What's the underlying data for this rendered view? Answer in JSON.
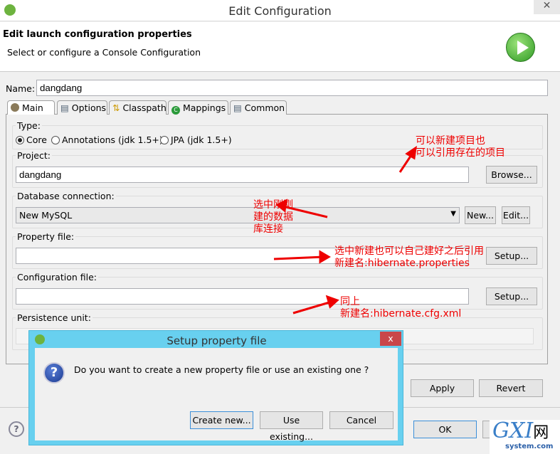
{
  "window": {
    "title": "Edit Configuration",
    "close": "✕"
  },
  "header": {
    "title": "Edit launch configuration properties",
    "subtitle": "Select or configure a Console Configuration"
  },
  "name": {
    "label": "Name:",
    "value": "dangdang"
  },
  "tabs": [
    {
      "label": "Main",
      "icon": "main-icon"
    },
    {
      "label": "Options",
      "icon": "table-icon"
    },
    {
      "label": "Classpath",
      "icon": "classpath-icon"
    },
    {
      "label": "Mappings",
      "icon": "mappings-icon"
    },
    {
      "label": "Common",
      "icon": "table-icon"
    }
  ],
  "type": {
    "label": "Type:",
    "options": [
      "Core",
      "Annotations (jdk 1.5+)",
      "JPA (jdk 1.5+)"
    ],
    "selected": "Core"
  },
  "project": {
    "label": "Project:",
    "value": "dangdang",
    "browse": "Browse..."
  },
  "db": {
    "label": "Database connection:",
    "value": "New MySQL",
    "new": "New...",
    "edit": "Edit..."
  },
  "property": {
    "label": "Property file:",
    "value": "",
    "setup": "Setup..."
  },
  "config": {
    "label": "Configuration file:",
    "value": "",
    "setup": "Setup..."
  },
  "persistence": {
    "label": "Persistence unit:"
  },
  "buttons": {
    "apply": "Apply",
    "revert": "Revert",
    "ok": "OK"
  },
  "annotations": {
    "a1": "可以新建项目也",
    "a2": "可以引用存在的项目",
    "b1": "选中刚刚",
    "b2": "建的数据",
    "b3": "库连接",
    "c1": "选中新建也可以自己建好之后引用",
    "c2": "新建名:hibernate.properties",
    "d1": "同上",
    "d2": "新建名:hibernate.cfg.xml"
  },
  "dialog": {
    "title": "Setup property file",
    "close": "x",
    "message": "Do you want to create a new property file or use an existing one ?",
    "create": "Create new...",
    "use": "Use existing...",
    "cancel": "Cancel"
  },
  "watermark": {
    "text": "GXI网",
    "sub": "system.com"
  },
  "colors": {
    "dialog_border": "#68d0ef",
    "annotation": "#ee0000",
    "close": "#c9474a"
  }
}
